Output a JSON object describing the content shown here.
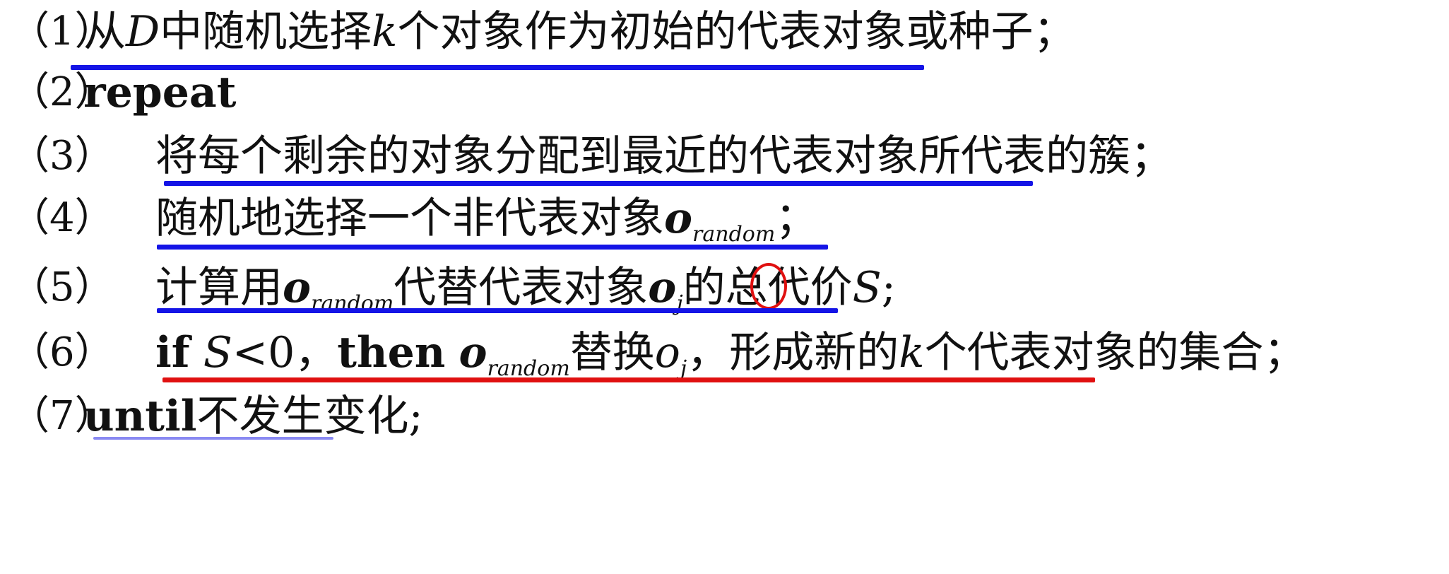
{
  "steps": [
    {
      "num": "（1）",
      "text_a": "从",
      "var_D": "D",
      "text_b": "中随机选择",
      "var_k": "k",
      "text_c": "个对象作为初始的代表对象或种子；"
    },
    {
      "num": "（2）",
      "keyword": "repeat"
    },
    {
      "num": "（3）",
      "text": "将每个剩余的对象分配到最近的代表对象所代表的簇；"
    },
    {
      "num": "（4）",
      "text_a": "随机地选择一个非代表对象",
      "var_o": "o",
      "sub": "random",
      "text_b": "；"
    },
    {
      "num": "（5）",
      "text_a": "计算用",
      "var_o": "o",
      "sub": "random",
      "text_b": "代替代表对象",
      "var_oj": "o",
      "sub_j": "j",
      "text_c": "的总代价",
      "var_S": "S",
      "text_d": ";"
    },
    {
      "num": "（6）",
      "kw_if": "if",
      "var_S": "S",
      "cond": "<0，",
      "kw_then": "then",
      "var_o": "o",
      "sub": "random",
      "text_a": "替换",
      "var_oj": "o",
      "sub_j": "j",
      "text_b": "，形成新的",
      "var_k": "k",
      "text_c": "个代表对象的集合；"
    },
    {
      "num": "（7）",
      "keyword": "until",
      "text": "不发生变化;"
    }
  ],
  "colors": {
    "underline_blue": "#1414e6",
    "underline_red": "#e01010",
    "circle_red": "#e01010",
    "text": "#111111"
  }
}
